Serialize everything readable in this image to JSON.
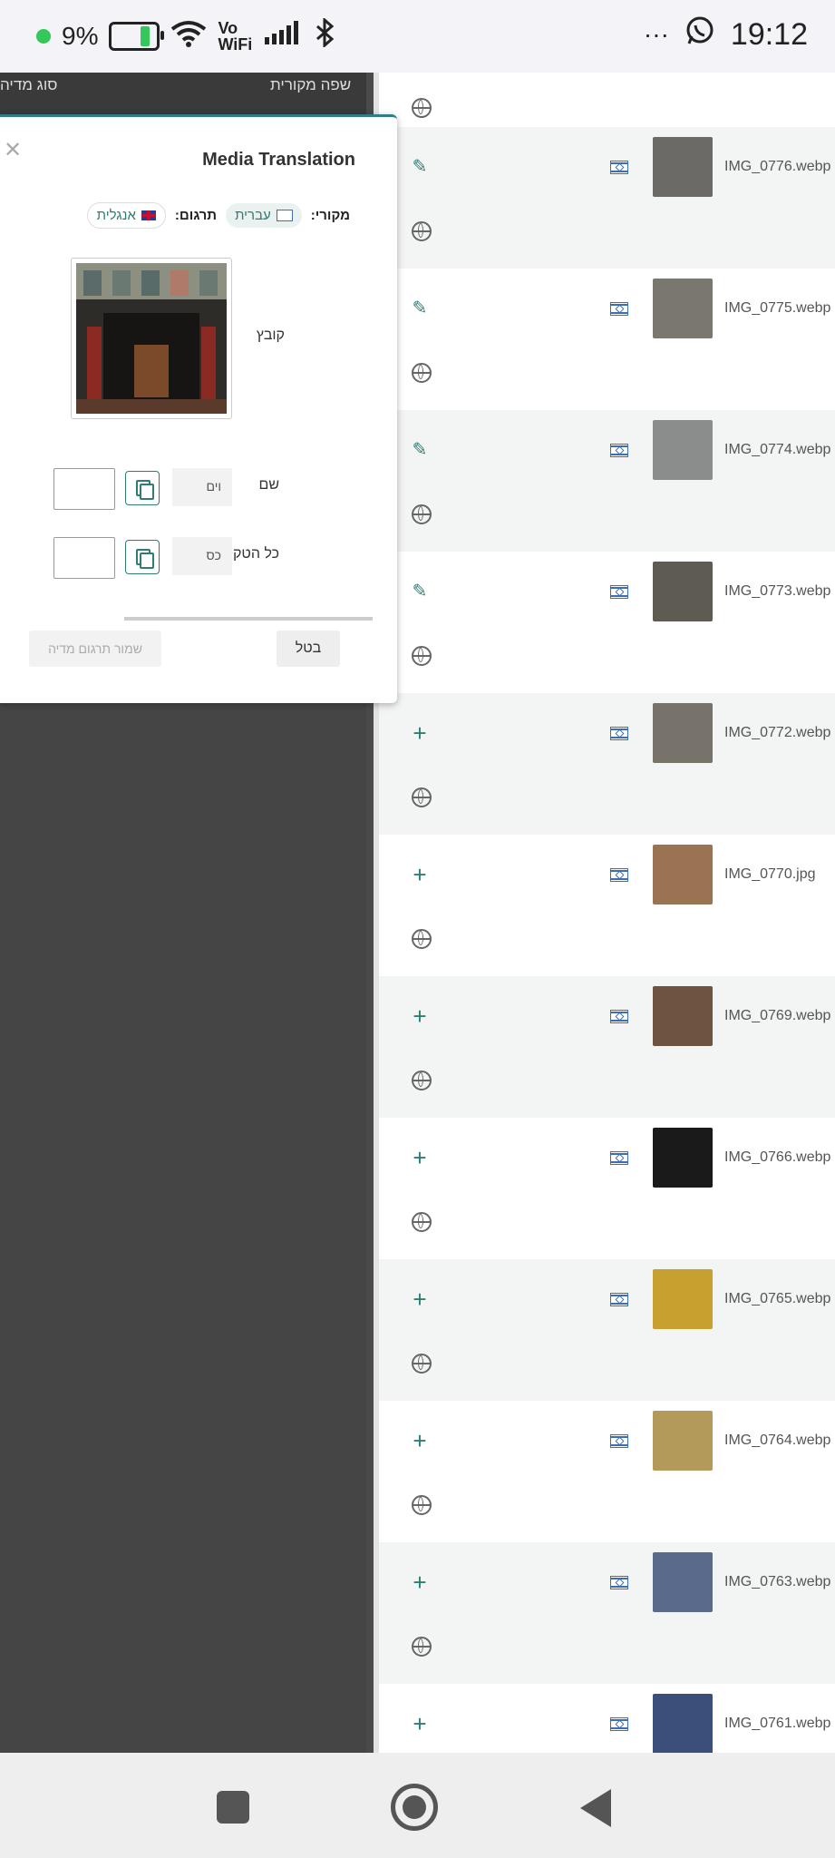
{
  "status_bar": {
    "battery_text": "9%",
    "network": "Vo WiFi",
    "time": "19:12",
    "more": "···"
  },
  "background_header": {
    "col_source_lang": "שפה מקורית",
    "col_media_type": "סוג מדיה"
  },
  "modal": {
    "title": "Media Translation",
    "source_label": "מקורי:",
    "source_lang": "עברית",
    "translation_label": "תרגום:",
    "target_lang": "אנגלית",
    "file_label": "קובץ",
    "fields": [
      {
        "label": "שם",
        "source_value": "וים",
        "translation_value": ""
      },
      {
        "label": "כל הטקסט",
        "source_value": "כס",
        "translation_value": ""
      }
    ],
    "cancel_label": "בטל",
    "save_label": "שמור תרגום מדיה"
  },
  "media_rows": [
    {
      "filename": "IMG_0776.webp",
      "action": "edit",
      "thumb_color": "#6b6a66"
    },
    {
      "filename": "IMG_0775.webp",
      "action": "edit",
      "thumb_color": "#7a776e"
    },
    {
      "filename": "IMG_0774.webp",
      "action": "edit",
      "thumb_color": "#8a8d8c"
    },
    {
      "filename": "IMG_0773.webp",
      "action": "edit",
      "thumb_color": "#5e5b52"
    },
    {
      "filename": "IMG_0772.webp",
      "action": "add",
      "thumb_color": "#77736a"
    },
    {
      "filename": "IMG_0770.jpg",
      "action": "add",
      "thumb_color": "#9a7452"
    },
    {
      "filename": "IMG_0769.webp",
      "action": "add",
      "thumb_color": "#6e5440"
    },
    {
      "filename": "IMG_0766.webp",
      "action": "add",
      "thumb_color": "#1a1a1a"
    },
    {
      "filename": "IMG_0765.webp",
      "action": "add",
      "thumb_color": "#c7a030"
    },
    {
      "filename": "IMG_0764.webp",
      "action": "add",
      "thumb_color": "#b39a5a"
    },
    {
      "filename": "IMG_0763.webp",
      "action": "add",
      "thumb_color": "#5a6a8a"
    },
    {
      "filename": "IMG_0761.webp",
      "action": "add",
      "thumb_color": "#3a4f7a"
    }
  ],
  "colors": {
    "accent": "#2e7d73",
    "modal_border": "#2d7e87",
    "overlay": "#454545"
  }
}
